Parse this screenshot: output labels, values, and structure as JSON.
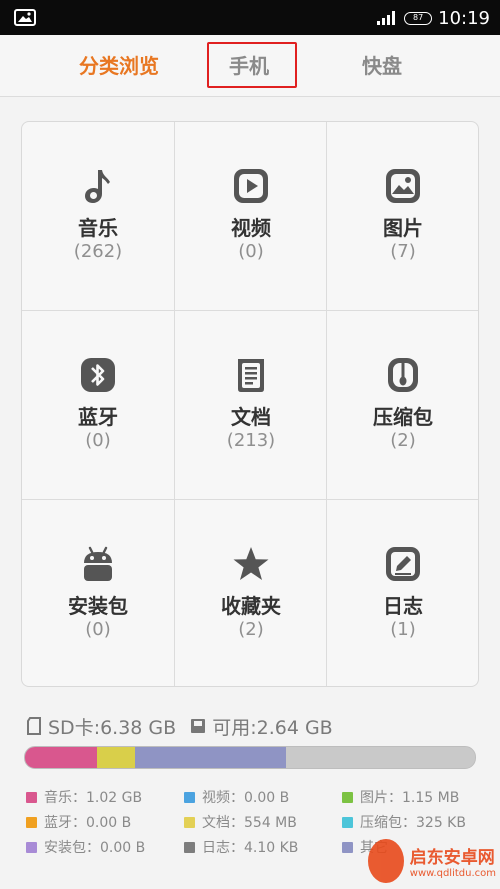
{
  "statusbar": {
    "time": "10:19",
    "battery": "87"
  },
  "tabs": [
    {
      "label": "分类浏览",
      "active": true
    },
    {
      "label": "手机",
      "active": false
    },
    {
      "label": "快盘",
      "active": false
    }
  ],
  "categories": [
    {
      "name": "音乐",
      "count": "(262)",
      "icon": "music-note-icon"
    },
    {
      "name": "视频",
      "count": "(0)",
      "icon": "video-play-icon"
    },
    {
      "name": "图片",
      "count": "(7)",
      "icon": "picture-icon"
    },
    {
      "name": "蓝牙",
      "count": "(0)",
      "icon": "bluetooth-icon"
    },
    {
      "name": "文档",
      "count": "(213)",
      "icon": "document-icon"
    },
    {
      "name": "压缩包",
      "count": "(2)",
      "icon": "zip-archive-icon"
    },
    {
      "name": "安装包",
      "count": "(0)",
      "icon": "android-icon"
    },
    {
      "name": "收藏夹",
      "count": "(2)",
      "icon": "star-icon"
    },
    {
      "name": "日志",
      "count": "(1)",
      "icon": "edit-log-icon"
    }
  ],
  "storage": {
    "sd_label": "SD卡:6.38 GB",
    "available_label": "可用:2.64 GB",
    "segments": [
      {
        "name": "music",
        "fraction": 0.16,
        "color": "#d9578e"
      },
      {
        "name": "docs",
        "fraction": 0.085,
        "color": "#d9cf4a"
      },
      {
        "name": "images",
        "fraction": 0.335,
        "color": "#8f94c4"
      },
      {
        "name": "free",
        "fraction": 0.42,
        "color": "#c9c9c9"
      }
    ]
  },
  "legend": [
    {
      "label": "音乐：1.02 GB",
      "color": "#d9578e"
    },
    {
      "label": "视频：0.00 B",
      "color": "#4ba3e0"
    },
    {
      "label": "图片：1.15 MB",
      "color": "#7cc242"
    },
    {
      "label": "蓝牙：0.00 B",
      "color": "#f0a020"
    },
    {
      "label": "文档：554 MB",
      "color": "#e3d055"
    },
    {
      "label": "压缩包：325 KB",
      "color": "#4cc5d9"
    },
    {
      "label": "安装包：0.00 B",
      "color": "#a88bd6"
    },
    {
      "label": "日志：4.10 KB",
      "color": "#7d7d7d"
    },
    {
      "label": "其它",
      "color": "#8f94c4"
    }
  ],
  "watermark": {
    "name": "启东安卓网",
    "url": "www.qdlitdu.com"
  }
}
